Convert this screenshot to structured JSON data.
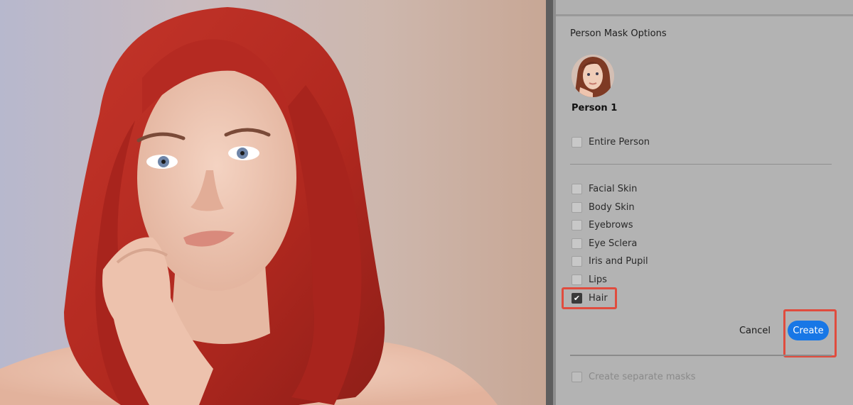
{
  "panel": {
    "title": "Person Mask Options",
    "person_name": "Person 1",
    "entire_person": {
      "label": "Entire Person",
      "checked": false
    },
    "parts": [
      {
        "label": "Facial Skin",
        "checked": false
      },
      {
        "label": "Body Skin",
        "checked": false
      },
      {
        "label": "Eyebrows",
        "checked": false
      },
      {
        "label": "Eye Sclera",
        "checked": false
      },
      {
        "label": "Iris and Pupil",
        "checked": false
      },
      {
        "label": "Lips",
        "checked": false
      },
      {
        "label": "Hair",
        "checked": true
      }
    ],
    "cancel_label": "Cancel",
    "create_label": "Create",
    "separate_masks": {
      "label": "Create separate masks",
      "checked": false,
      "disabled": true
    }
  },
  "colors": {
    "accent": "#1877e6",
    "highlight": "#e04c3e",
    "hair": "#b52a22"
  }
}
